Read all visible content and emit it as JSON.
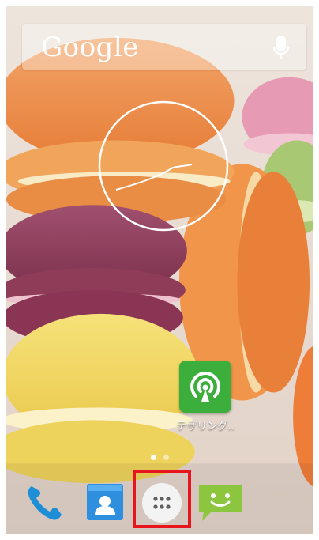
{
  "search": {
    "logo_text": "Google",
    "icons": [
      "mic-icon"
    ]
  },
  "home": {
    "shortcut": {
      "label": "テザリング..",
      "icon": "tethering-icon",
      "color": "#3cae3c"
    },
    "page_indicator": {
      "pages": 2,
      "current": 1
    }
  },
  "dock": {
    "items": [
      "phone-icon",
      "contacts-icon",
      "app-drawer-icon",
      "messaging-icon"
    ],
    "highlighted": "app-drawer-icon",
    "highlight_color": "#e8141e"
  },
  "overlay": {
    "gesture": "circle-gesture"
  }
}
